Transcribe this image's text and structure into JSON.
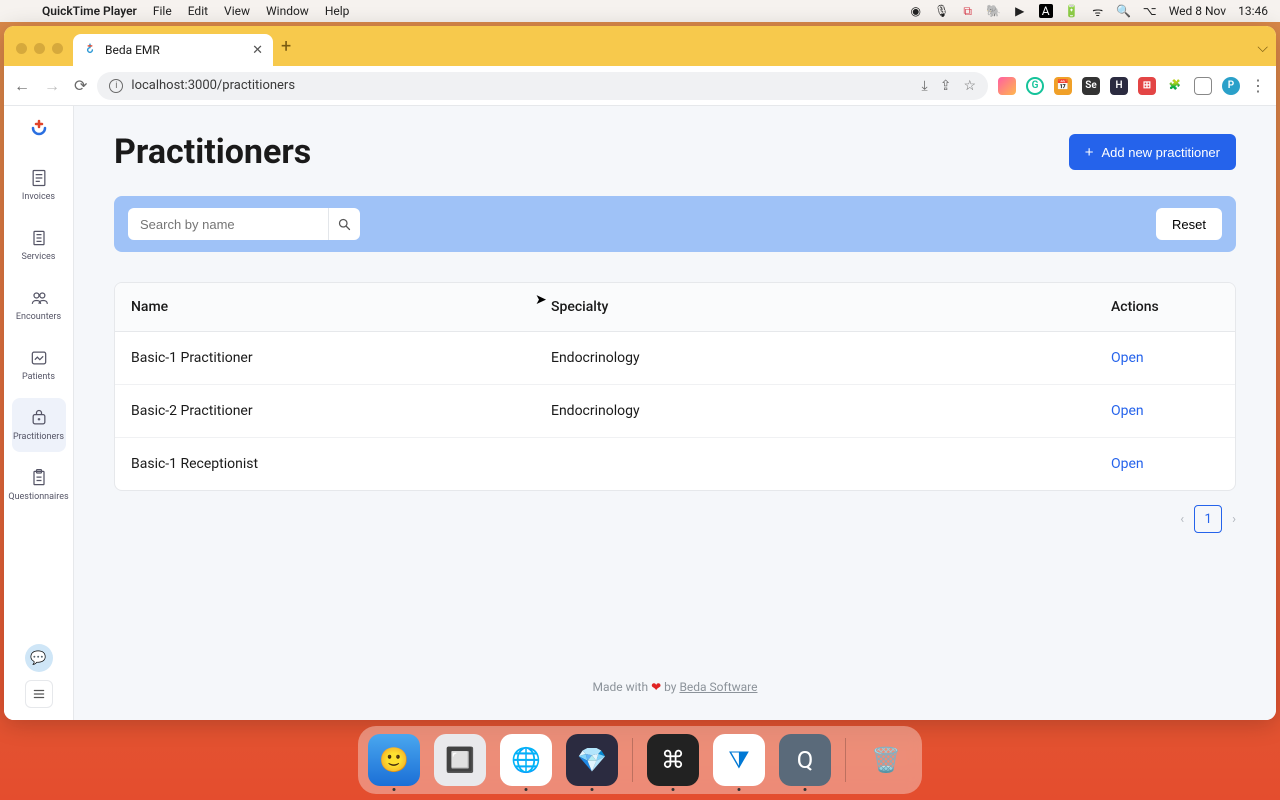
{
  "menubar": {
    "appname": "QuickTime Player",
    "items": [
      "File",
      "Edit",
      "View",
      "Window",
      "Help"
    ],
    "date": "Wed 8 Nov",
    "time": "13:46"
  },
  "browser": {
    "tab_title": "Beda EMR",
    "url": "localhost:3000/practitioners"
  },
  "sidebar": {
    "items": [
      {
        "label": "Invoices",
        "icon": "invoices"
      },
      {
        "label": "Services",
        "icon": "services"
      },
      {
        "label": "Encounters",
        "icon": "encounters"
      },
      {
        "label": "Patients",
        "icon": "patients"
      },
      {
        "label": "Practitioners",
        "icon": "practitioners",
        "active": true
      },
      {
        "label": "Questionnaires",
        "icon": "questionnaires"
      }
    ]
  },
  "page": {
    "title": "Practitioners",
    "add_button": "Add new practitioner",
    "search_placeholder": "Search by name",
    "reset": "Reset",
    "columns": [
      "Name",
      "Specialty",
      "Actions"
    ],
    "rows": [
      {
        "name": "Basic-1 Practitioner",
        "specialty": "Endocrinology",
        "action": "Open"
      },
      {
        "name": "Basic-2 Practitioner",
        "specialty": "Endocrinology",
        "action": "Open"
      },
      {
        "name": "Basic-1 Receptionist",
        "specialty": "",
        "action": "Open"
      }
    ],
    "pagination": {
      "current": "1"
    },
    "footer_prefix": "Made with ",
    "footer_mid": " by ",
    "footer_link": "Beda Software"
  }
}
